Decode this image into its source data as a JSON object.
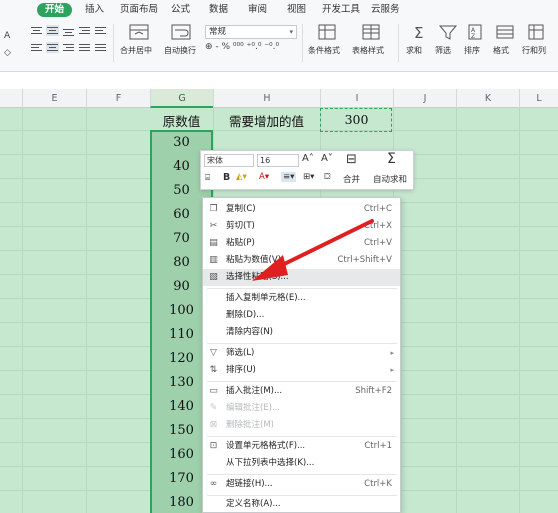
{
  "ribbon": {
    "tabs": [
      "开始",
      "插入",
      "页面布局",
      "公式",
      "数据",
      "审阅",
      "视图",
      "开发工具",
      "云服务"
    ],
    "buttons": {
      "merge": "合并居中",
      "wrap": "自动换行",
      "number_format": "常规",
      "number_line": "⊕ - % ⁰⁰⁰ ⁺⁰.⁰ ⁻⁰.⁰",
      "cond_format": "条件格式",
      "table_style": "表格样式",
      "sum": "求和",
      "filter": "筛选",
      "sort": "排序",
      "format": "格式",
      "rowcol": "行和列"
    }
  },
  "sheet": {
    "columns": [
      "E",
      "F",
      "G",
      "H",
      "I",
      "J",
      "K",
      "L"
    ],
    "selected_column": "G",
    "header_G": "原数值",
    "header_H": "需要增加的值",
    "value_I": "300",
    "values_G": [
      "30",
      "40",
      "50",
      "60",
      "70",
      "80",
      "90",
      "100",
      "110",
      "120",
      "130",
      "140",
      "150",
      "160",
      "170",
      "180"
    ]
  },
  "mini_toolbar": {
    "font": "宋体",
    "size": "16",
    "merge": "合并",
    "autosum": "自动求和"
  },
  "context_menu": {
    "items": [
      {
        "icon": "copy-icon",
        "label": "复制(C)",
        "shortcut": "Ctrl+C"
      },
      {
        "icon": "cut-icon",
        "label": "剪切(T)",
        "shortcut": "Ctrl+X"
      },
      {
        "icon": "paste-icon",
        "label": "粘贴(P)",
        "shortcut": "Ctrl+V"
      },
      {
        "icon": "paste-values-icon",
        "label": "粘贴为数值(V)",
        "shortcut": "Ctrl+Shift+V"
      },
      {
        "icon": "paste-special-icon",
        "label": "选择性粘贴(S)...",
        "shortcut": ""
      },
      {
        "icon": "",
        "label": "插入复制单元格(E)...",
        "shortcut": ""
      },
      {
        "icon": "",
        "label": "删除(D)...",
        "shortcut": ""
      },
      {
        "icon": "",
        "label": "清除内容(N)",
        "shortcut": ""
      },
      {
        "icon": "filter-icon",
        "label": "筛选(L)",
        "shortcut": ""
      },
      {
        "icon": "sort-icon",
        "label": "排序(U)",
        "shortcut": ""
      },
      {
        "icon": "comment-icon",
        "label": "插入批注(M)...",
        "shortcut": "Shift+F2"
      },
      {
        "icon": "edit-comment-icon",
        "label": "编辑批注(E)...",
        "shortcut": ""
      },
      {
        "icon": "delete-comment-icon",
        "label": "删除批注(M)",
        "shortcut": ""
      },
      {
        "icon": "format-cells-icon",
        "label": "设置单元格格式(F)...",
        "shortcut": "Ctrl+1"
      },
      {
        "icon": "",
        "label": "从下拉列表中选择(K)...",
        "shortcut": ""
      },
      {
        "icon": "link-icon",
        "label": "超链接(H)...",
        "shortcut": "Ctrl+K"
      },
      {
        "icon": "",
        "label": "定义名称(A)...",
        "shortcut": ""
      }
    ]
  },
  "colors": {
    "accent": "#2ea35e",
    "sheet_bg": "#c5e8cf",
    "selection": "#9fd0ac",
    "arrow": "#e02020"
  }
}
